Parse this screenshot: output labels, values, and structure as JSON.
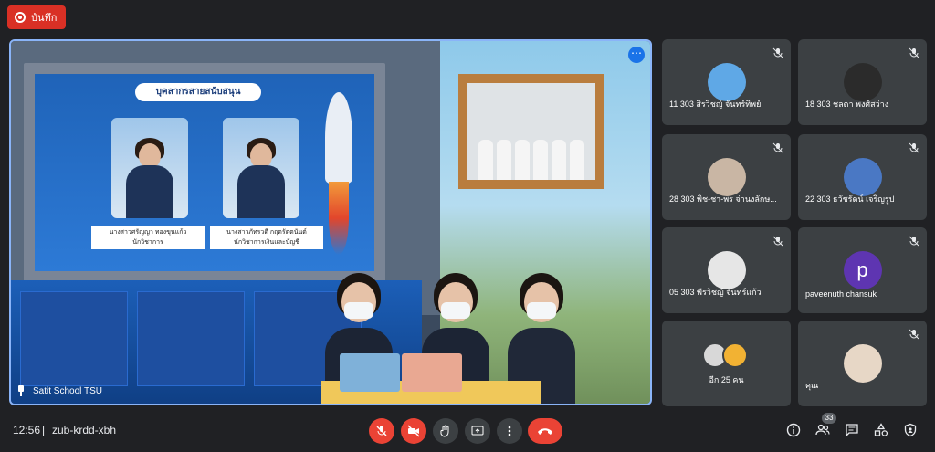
{
  "recording": {
    "label": "บันทึก"
  },
  "stage": {
    "banner": "บุคลากรสายสนับสนุน",
    "card_left_name": "นางสาวศรัญญา ทองขุนแก้ว",
    "card_left_role": "นักวิชาการ",
    "card_right_name": "นางสาวภัทรวดี กฤตรัตตนันต์",
    "card_right_role": "นักวิชาการเงินและบัญชี",
    "presenter_label": "Satit School TSU"
  },
  "participants": [
    {
      "name": "11 303 สิรวิชญ์ จันทร์ทิพย์",
      "avatar_color": "#5fa8e6"
    },
    {
      "name": "18 303 ชลดา พงศ์สว่าง",
      "avatar_color": "#2b2b2b"
    },
    {
      "name": "28 303 พิช-ชา-พร จ่านงลักษ...",
      "avatar_color": "#c9b6a4"
    },
    {
      "name": "22 303 ธวัชรัตน์ เจริญรูป",
      "avatar_color": "#4a78c4"
    },
    {
      "name": "05 303 พีรวิชญ์ จันทร์แก้ว",
      "avatar_color": "#e6e6e6"
    },
    {
      "name": "paveenuth chansuk",
      "avatar_letter": "p",
      "avatar_color": "#5e35b1"
    },
    {
      "name": "อีก 25 คน"
    },
    {
      "name": "คุณ",
      "avatar_color": "#e7d7c6"
    }
  ],
  "bottom": {
    "time": "12:56",
    "separator": "|",
    "meeting_code": "zub-krdd-xbh",
    "participant_count": "33"
  },
  "colors": {
    "accent": "#8ab4f8",
    "danger": "#ea4335",
    "tile": "#3c4043",
    "bg": "#202124"
  }
}
